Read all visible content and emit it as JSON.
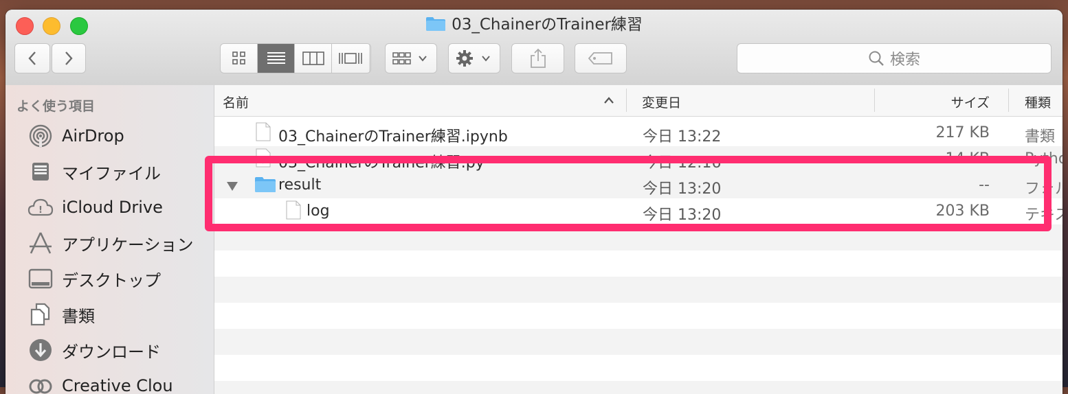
{
  "window": {
    "title": "03_ChainerのTrainer練習"
  },
  "toolbar": {
    "back_icon": "chevron-left-icon",
    "forward_icon": "chevron-right-icon",
    "search_placeholder": "検索"
  },
  "sidebar": {
    "header": "よく使う項目",
    "items": [
      {
        "label": "AirDrop",
        "icon": "airdrop-icon"
      },
      {
        "label": "マイファイル",
        "icon": "all-files-icon"
      },
      {
        "label": "iCloud Drive",
        "icon": "cloud-icon"
      },
      {
        "label": "アプリケーション",
        "icon": "applications-icon"
      },
      {
        "label": "デスクトップ",
        "icon": "desktop-icon"
      },
      {
        "label": "書類",
        "icon": "documents-icon"
      },
      {
        "label": "ダウンロード",
        "icon": "download-icon"
      },
      {
        "label": "Creative Clou",
        "icon": "creative-cloud-icon"
      }
    ]
  },
  "columns": {
    "name": "名前",
    "date": "変更日",
    "size": "サイズ",
    "kind": "種類"
  },
  "files": [
    {
      "name": "03_ChainerのTrainer練習.ipynb",
      "date": "今日 13:22",
      "size": "217 KB",
      "kind": "書類"
    },
    {
      "name": "03_ChainerのTrainer練習.py",
      "date": "今日 12:16",
      "size": "14 KB",
      "kind": "Pytho"
    },
    {
      "name": "result",
      "date": "今日 13:20",
      "size": "--",
      "kind": "フォル"
    },
    {
      "name": "log",
      "date": "今日 13:20",
      "size": "203 KB",
      "kind": "テキス"
    }
  ],
  "colors": {
    "highlight": "#ff2d70",
    "folder": "#5ab2f0"
  }
}
